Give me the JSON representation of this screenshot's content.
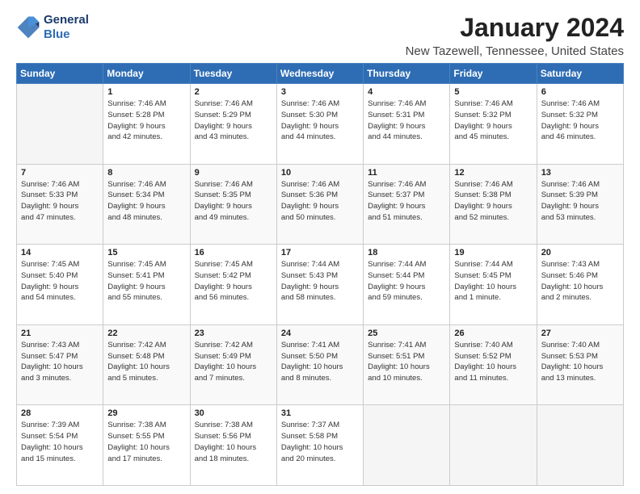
{
  "header": {
    "logo": {
      "line1": "General",
      "line2": "Blue"
    },
    "title": "January 2024",
    "subtitle": "New Tazewell, Tennessee, United States"
  },
  "columns": [
    "Sunday",
    "Monday",
    "Tuesday",
    "Wednesday",
    "Thursday",
    "Friday",
    "Saturday"
  ],
  "weeks": [
    [
      {
        "day": "",
        "info": ""
      },
      {
        "day": "1",
        "info": "Sunrise: 7:46 AM\nSunset: 5:28 PM\nDaylight: 9 hours\nand 42 minutes."
      },
      {
        "day": "2",
        "info": "Sunrise: 7:46 AM\nSunset: 5:29 PM\nDaylight: 9 hours\nand 43 minutes."
      },
      {
        "day": "3",
        "info": "Sunrise: 7:46 AM\nSunset: 5:30 PM\nDaylight: 9 hours\nand 44 minutes."
      },
      {
        "day": "4",
        "info": "Sunrise: 7:46 AM\nSunset: 5:31 PM\nDaylight: 9 hours\nand 44 minutes."
      },
      {
        "day": "5",
        "info": "Sunrise: 7:46 AM\nSunset: 5:32 PM\nDaylight: 9 hours\nand 45 minutes."
      },
      {
        "day": "6",
        "info": "Sunrise: 7:46 AM\nSunset: 5:32 PM\nDaylight: 9 hours\nand 46 minutes."
      }
    ],
    [
      {
        "day": "7",
        "info": "Sunrise: 7:46 AM\nSunset: 5:33 PM\nDaylight: 9 hours\nand 47 minutes."
      },
      {
        "day": "8",
        "info": "Sunrise: 7:46 AM\nSunset: 5:34 PM\nDaylight: 9 hours\nand 48 minutes."
      },
      {
        "day": "9",
        "info": "Sunrise: 7:46 AM\nSunset: 5:35 PM\nDaylight: 9 hours\nand 49 minutes."
      },
      {
        "day": "10",
        "info": "Sunrise: 7:46 AM\nSunset: 5:36 PM\nDaylight: 9 hours\nand 50 minutes."
      },
      {
        "day": "11",
        "info": "Sunrise: 7:46 AM\nSunset: 5:37 PM\nDaylight: 9 hours\nand 51 minutes."
      },
      {
        "day": "12",
        "info": "Sunrise: 7:46 AM\nSunset: 5:38 PM\nDaylight: 9 hours\nand 52 minutes."
      },
      {
        "day": "13",
        "info": "Sunrise: 7:46 AM\nSunset: 5:39 PM\nDaylight: 9 hours\nand 53 minutes."
      }
    ],
    [
      {
        "day": "14",
        "info": "Sunrise: 7:45 AM\nSunset: 5:40 PM\nDaylight: 9 hours\nand 54 minutes."
      },
      {
        "day": "15",
        "info": "Sunrise: 7:45 AM\nSunset: 5:41 PM\nDaylight: 9 hours\nand 55 minutes."
      },
      {
        "day": "16",
        "info": "Sunrise: 7:45 AM\nSunset: 5:42 PM\nDaylight: 9 hours\nand 56 minutes."
      },
      {
        "day": "17",
        "info": "Sunrise: 7:44 AM\nSunset: 5:43 PM\nDaylight: 9 hours\nand 58 minutes."
      },
      {
        "day": "18",
        "info": "Sunrise: 7:44 AM\nSunset: 5:44 PM\nDaylight: 9 hours\nand 59 minutes."
      },
      {
        "day": "19",
        "info": "Sunrise: 7:44 AM\nSunset: 5:45 PM\nDaylight: 10 hours\nand 1 minute."
      },
      {
        "day": "20",
        "info": "Sunrise: 7:43 AM\nSunset: 5:46 PM\nDaylight: 10 hours\nand 2 minutes."
      }
    ],
    [
      {
        "day": "21",
        "info": "Sunrise: 7:43 AM\nSunset: 5:47 PM\nDaylight: 10 hours\nand 3 minutes."
      },
      {
        "day": "22",
        "info": "Sunrise: 7:42 AM\nSunset: 5:48 PM\nDaylight: 10 hours\nand 5 minutes."
      },
      {
        "day": "23",
        "info": "Sunrise: 7:42 AM\nSunset: 5:49 PM\nDaylight: 10 hours\nand 7 minutes."
      },
      {
        "day": "24",
        "info": "Sunrise: 7:41 AM\nSunset: 5:50 PM\nDaylight: 10 hours\nand 8 minutes."
      },
      {
        "day": "25",
        "info": "Sunrise: 7:41 AM\nSunset: 5:51 PM\nDaylight: 10 hours\nand 10 minutes."
      },
      {
        "day": "26",
        "info": "Sunrise: 7:40 AM\nSunset: 5:52 PM\nDaylight: 10 hours\nand 11 minutes."
      },
      {
        "day": "27",
        "info": "Sunrise: 7:40 AM\nSunset: 5:53 PM\nDaylight: 10 hours\nand 13 minutes."
      }
    ],
    [
      {
        "day": "28",
        "info": "Sunrise: 7:39 AM\nSunset: 5:54 PM\nDaylight: 10 hours\nand 15 minutes."
      },
      {
        "day": "29",
        "info": "Sunrise: 7:38 AM\nSunset: 5:55 PM\nDaylight: 10 hours\nand 17 minutes."
      },
      {
        "day": "30",
        "info": "Sunrise: 7:38 AM\nSunset: 5:56 PM\nDaylight: 10 hours\nand 18 minutes."
      },
      {
        "day": "31",
        "info": "Sunrise: 7:37 AM\nSunset: 5:58 PM\nDaylight: 10 hours\nand 20 minutes."
      },
      {
        "day": "",
        "info": ""
      },
      {
        "day": "",
        "info": ""
      },
      {
        "day": "",
        "info": ""
      }
    ]
  ]
}
